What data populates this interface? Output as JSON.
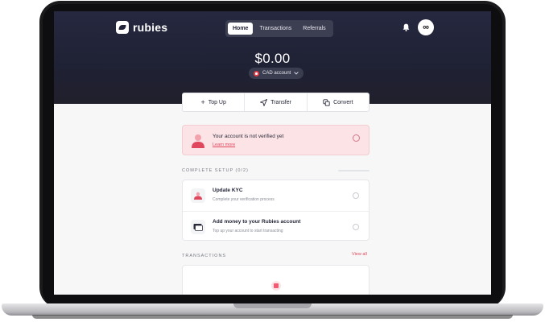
{
  "app": {
    "name": "rubies"
  },
  "nav": {
    "tabs": [
      {
        "label": "Home",
        "active": true
      },
      {
        "label": "Transactions",
        "active": false
      },
      {
        "label": "Referrals",
        "active": false
      }
    ]
  },
  "header": {
    "avatar_glyph": "∞",
    "balance": "$0.00",
    "account": "CAD account"
  },
  "actions": [
    {
      "label": "Top Up",
      "icon": "plus-icon"
    },
    {
      "label": "Transfer",
      "icon": "send-icon"
    },
    {
      "label": "Convert",
      "icon": "convert-icon"
    }
  ],
  "alert": {
    "title": "Your account is not verified yet",
    "link": "Learn more"
  },
  "setup": {
    "title": "COMPLETE SETUP (0/2)",
    "items": [
      {
        "title": "Update KYC",
        "desc": "Complete your verification process"
      },
      {
        "title": "Add money to your Rubies account",
        "desc": "Top up your account to start transacting"
      }
    ]
  },
  "transactions": {
    "title": "TRANSACTIONS",
    "view_all": "View all"
  },
  "colors": {
    "accent": "#e0475d",
    "hero": "#1f2134"
  }
}
